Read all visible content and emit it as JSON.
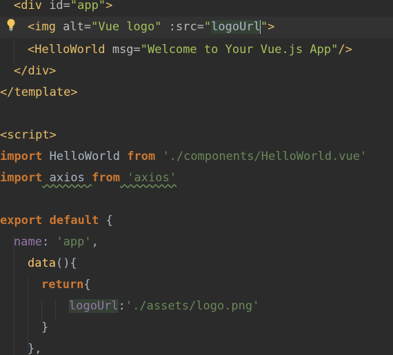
{
  "code": {
    "l1": {
      "tag_open": "<div",
      "attr": " id=",
      "value": "\"app\"",
      "tag_close": ">"
    },
    "l2": {
      "tag_open": "<img",
      "attr1": " alt=",
      "value1": "\"Vue logo\"",
      "attr2": " :src=",
      "q1": "\"",
      "bind": "logoUrl",
      "q2": "\"",
      "tag_close": ">"
    },
    "l3": {
      "tag_open": "<HelloWorld",
      "attr": " msg=",
      "value": "\"Welcome to Your Vue.js App\"",
      "tag_close": "/>"
    },
    "l4": {
      "tag": "</div>"
    },
    "l5": {
      "tag": "</template>"
    },
    "l7": {
      "tag": "<script>"
    },
    "l8": {
      "kw1": "import",
      "name": " HelloWorld ",
      "kw2": "from",
      "path": " './components/HelloWorld.vue'"
    },
    "l9": {
      "kw1": "import",
      "name": " axios ",
      "kw2": "from",
      "path": " 'axios'"
    },
    "l11": {
      "kw1": "export",
      "kw2": " default",
      "brace": " {"
    },
    "l12": {
      "prop": "name",
      "colon": ": ",
      "value": "'app'",
      "comma": ","
    },
    "l13": {
      "fn": "data",
      "rest": "(){"
    },
    "l14": {
      "kw": "return",
      "brace": "{"
    },
    "l15": {
      "prop": "logoUrl",
      "colon": ":",
      "value": "'./assets/logo.png'"
    },
    "l16": {
      "brace": "}"
    },
    "l17": {
      "brace": "},"
    }
  },
  "icons": {
    "intention": "lightbulb-icon"
  },
  "colors": {
    "background": "#2b2b2b",
    "keyword": "#cc7832",
    "tag": "#e8bf6a",
    "string": "#a5c25c",
    "property": "#9876aa"
  }
}
